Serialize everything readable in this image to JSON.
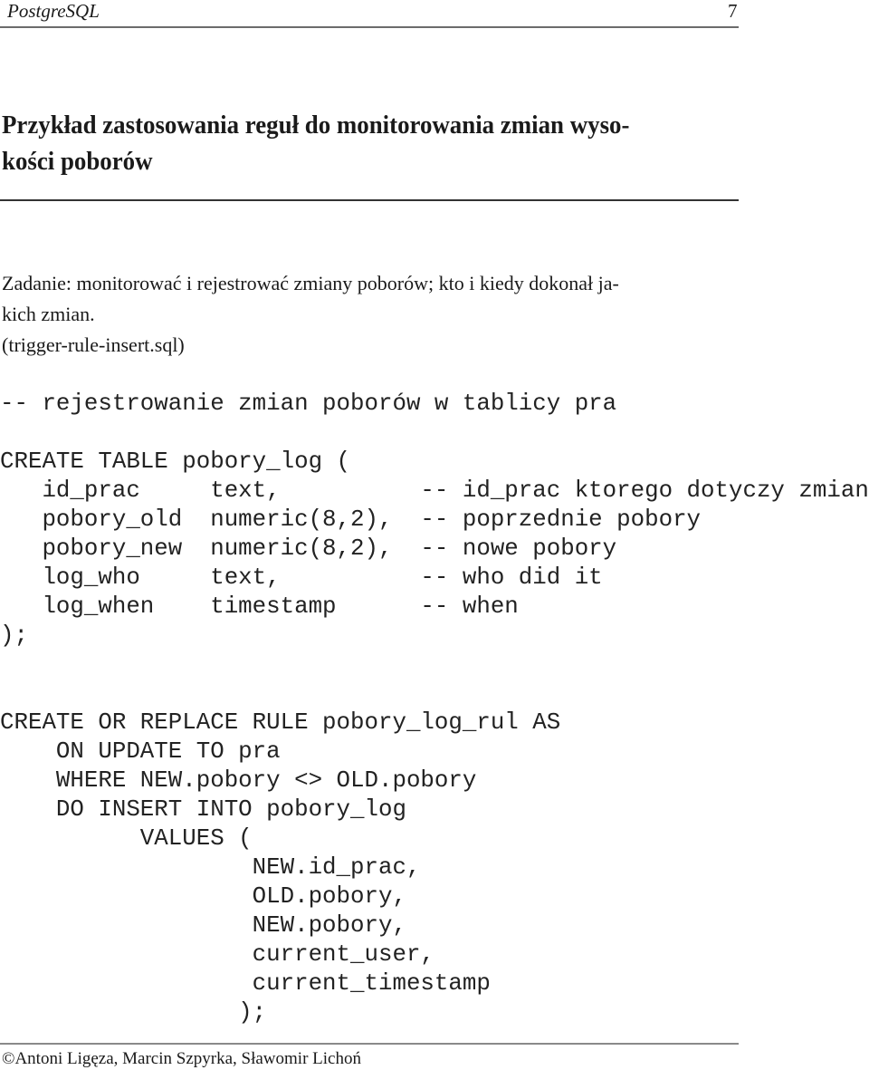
{
  "header": {
    "running_title": "PostgreSQL",
    "page_number": "7"
  },
  "section": {
    "title_line1": "Przykład zastosowania reguł do monitorowania zmian wyso-",
    "title_line2": "kości poborów"
  },
  "intro": {
    "line1": "Zadanie: monitorować i rejestrować zmiany poborów; kto i kiedy dokonał ja-",
    "line2": "kich zmian.",
    "filename": "(trigger-rule-insert.sql)"
  },
  "code": {
    "lines": [
      "-- rejestrowanie zmian poborów w tablicy pra",
      "",
      "CREATE TABLE pobory_log (",
      "   id_prac     text,          -- id_prac ktorego dotyczy zmiana",
      "   pobory_old  numeric(8,2),  -- poprzednie pobory",
      "   pobory_new  numeric(8,2),  -- nowe pobory",
      "   log_who     text,          -- who did it",
      "   log_when    timestamp      -- when",
      ");",
      "",
      "",
      "CREATE OR REPLACE RULE pobory_log_rul AS",
      "    ON UPDATE TO pra",
      "    WHERE NEW.pobory <> OLD.pobory",
      "    DO INSERT INTO pobory_log",
      "          VALUES (",
      "                  NEW.id_prac,",
      "                  OLD.pobory,",
      "                  NEW.pobory,",
      "                  current_user,",
      "                  current_timestamp",
      "                 );"
    ]
  },
  "footer": {
    "copyright_symbol": "©",
    "authors": "Antoni Ligęza, Marcin Szpyrka, Sławomir Lichoń"
  }
}
